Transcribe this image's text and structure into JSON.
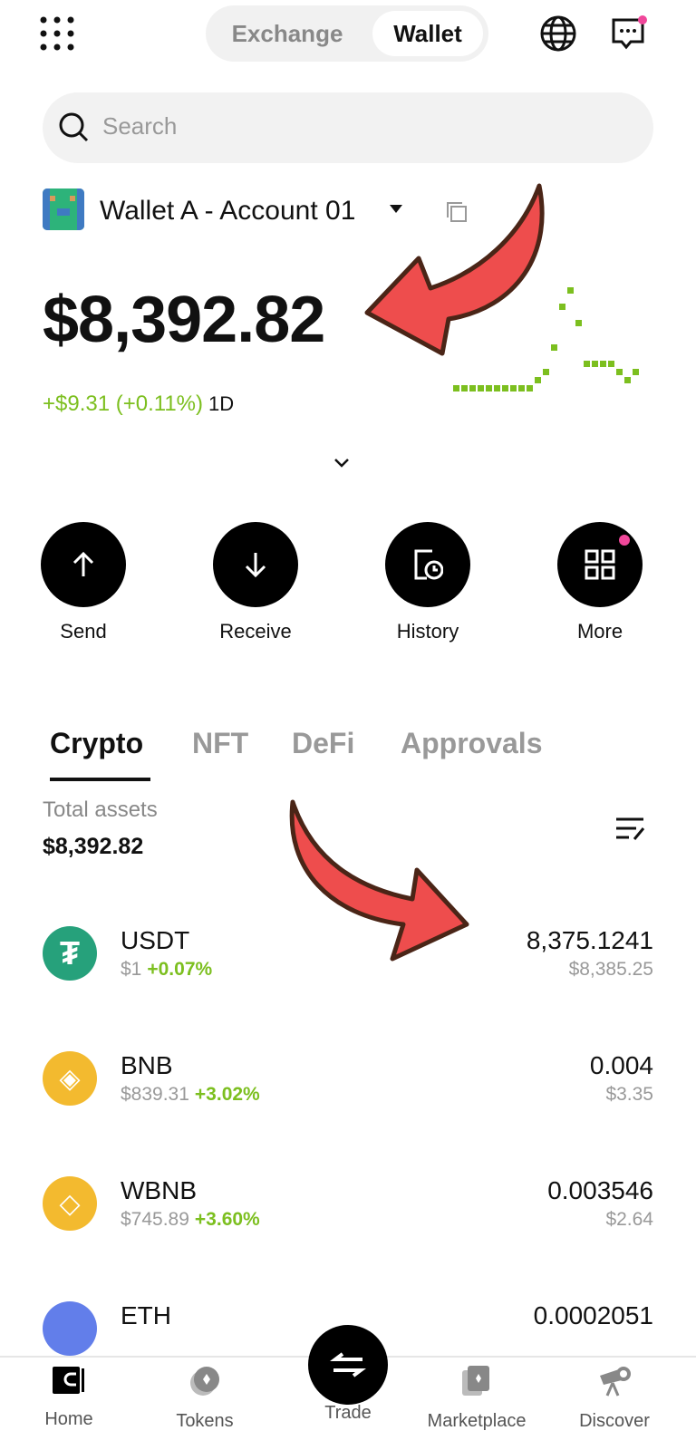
{
  "header": {
    "tabs": [
      {
        "label": "Exchange",
        "active": false
      },
      {
        "label": "Wallet",
        "active": true
      }
    ],
    "icons": [
      "grid-menu-icon",
      "globe-icon",
      "chat-icon"
    ],
    "notification_dot_color": "#f0479a"
  },
  "search": {
    "placeholder": "Search"
  },
  "account": {
    "name": "Wallet A - Account 01"
  },
  "balance": {
    "value": "$8,392.82",
    "change": "+$9.31 (+0.11%)",
    "period": "1D",
    "change_color": "#7cbf1f"
  },
  "actions": [
    {
      "label": "Send",
      "icon": "arrow-up-icon"
    },
    {
      "label": "Receive",
      "icon": "arrow-down-icon"
    },
    {
      "label": "History",
      "icon": "history-icon"
    },
    {
      "label": "More",
      "icon": "more-grid-icon"
    }
  ],
  "asset_tabs": [
    {
      "label": "Crypto",
      "active": true
    },
    {
      "label": "NFT"
    },
    {
      "label": "DeFi"
    },
    {
      "label": "Approvals"
    }
  ],
  "total": {
    "label": "Total assets",
    "value": "$8,392.82"
  },
  "assets": [
    {
      "symbol": "USDT",
      "price": "$1",
      "change": "+0.07%",
      "amount": "8,375.1241",
      "usd": "$8,385.25",
      "color": "#26a17b"
    },
    {
      "symbol": "BNB",
      "price": "$839.31",
      "change": "+3.02%",
      "amount": "0.004",
      "usd": "$3.35",
      "color": "#f3ba2f"
    },
    {
      "symbol": "WBNB",
      "price": "$745.89",
      "change": "+3.60%",
      "amount": "0.003546",
      "usd": "$2.64",
      "color": "#f3ba2f"
    },
    {
      "symbol": "ETH",
      "price": "",
      "change": "",
      "amount": "0.0002051",
      "usd": "",
      "color": "#627eea"
    }
  ],
  "nav": [
    {
      "label": "Home",
      "active": true
    },
    {
      "label": "Tokens"
    },
    {
      "label": "Trade"
    },
    {
      "label": "Marketplace"
    },
    {
      "label": "Discover"
    }
  ]
}
